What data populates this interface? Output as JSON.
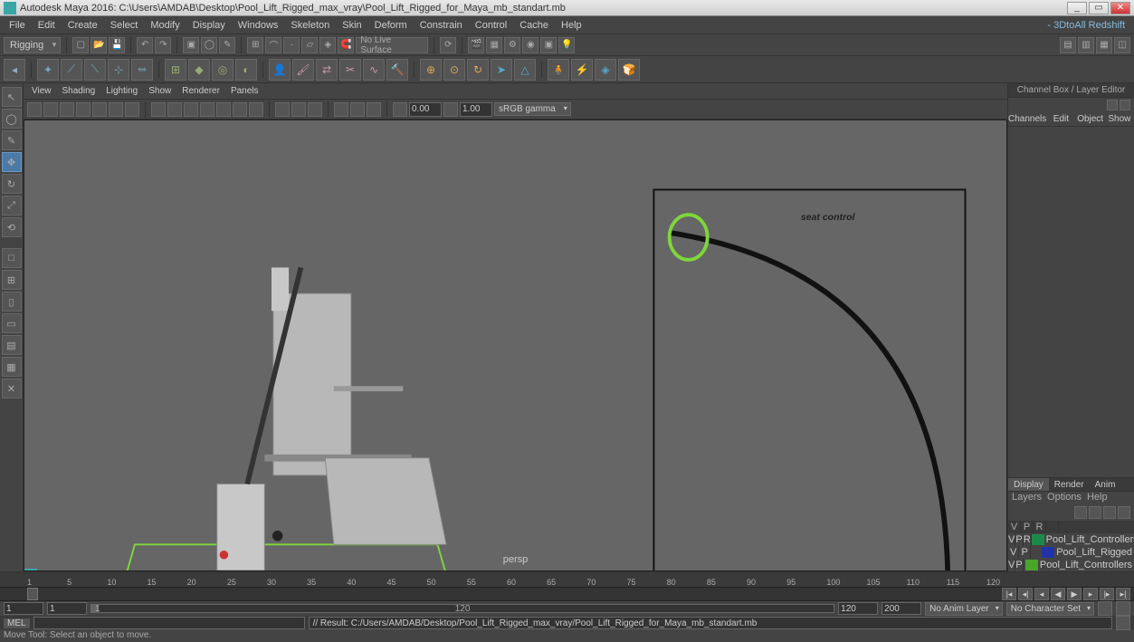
{
  "title": "Autodesk Maya 2016: C:\\Users\\AMDAB\\Desktop\\Pool_Lift_Rigged_max_vray\\Pool_Lift_Rigged_for_Maya_mb_standart.mb",
  "menus": [
    "File",
    "Edit",
    "Create",
    "Select",
    "Modify",
    "Display",
    "Windows",
    "Skeleton",
    "Skin",
    "Deform",
    "Constrain",
    "Control",
    "Cache",
    "Help"
  ],
  "menu_right": "- 3DtoAll  Redshift",
  "workspace": "Rigging",
  "no_live_surface": "No Live Surface",
  "panel_menus": [
    "View",
    "Shading",
    "Lighting",
    "Show",
    "Renderer",
    "Panels"
  ],
  "near": "0.00",
  "far": "1.00",
  "gamma_mode": "sRGB gamma",
  "camera_label": "persp",
  "channel_title": "Channel Box / Layer Editor",
  "channel_tabs": [
    "Channels",
    "Edit",
    "Object",
    "Show"
  ],
  "layer_tabs": [
    "Display",
    "Render",
    "Anim"
  ],
  "layer_subtabs": [
    "Layers",
    "Options",
    "Help"
  ],
  "layer_header": {
    "v": "V",
    "p": "P",
    "r": "R"
  },
  "layers": [
    {
      "v": "V",
      "p": "P",
      "r": "R",
      "color": "#1a8a4a",
      "name": "Pool_Lift_Controllers_f"
    },
    {
      "v": "V",
      "p": "P",
      "r": "",
      "color": "#2233aa",
      "name": "Pool_Lift_Rigged"
    },
    {
      "v": "V",
      "p": "P",
      "r": "",
      "color": "#4aa52a",
      "name": "Pool_Lift_Controllers"
    }
  ],
  "time_ticks": [
    "1",
    "5",
    "10",
    "15",
    "20",
    "25",
    "30",
    "35",
    "40",
    "45",
    "50",
    "55",
    "60",
    "65",
    "70",
    "75",
    "80",
    "85",
    "90",
    "95",
    "100",
    "105",
    "110",
    "115",
    "120"
  ],
  "frame_current": "1",
  "range_start": "1",
  "range_startbox": "1",
  "range_mid": "1",
  "range_midlabel": "120",
  "range_end": "120",
  "range_end2": "200",
  "anim_layer": "No Anim Layer",
  "char_set": "No Character Set",
  "mel_label": "MEL",
  "mel_output": "// Result: C:/Users/AMDAB/Desktop/Pool_Lift_Rigged_max_vray/Pool_Lift_Rigged_for_Maya_mb_standart.mb",
  "status_bar": "Move Tool: Select an object to move.",
  "viewport_text": "seat control"
}
